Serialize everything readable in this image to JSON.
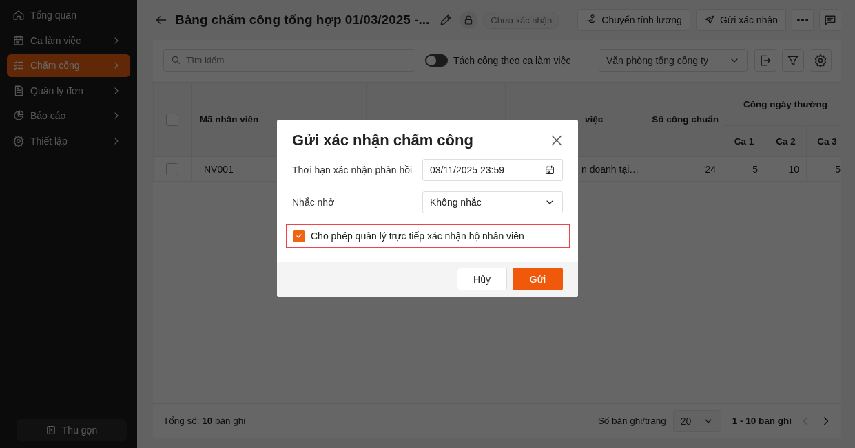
{
  "sidebar": {
    "items": [
      {
        "label": "Tổng quan",
        "has_children": false,
        "selected": false
      },
      {
        "label": "Ca làm việc",
        "has_children": true,
        "selected": false
      },
      {
        "label": "Chấm công",
        "has_children": true,
        "selected": true
      },
      {
        "label": "Quản lý đơn",
        "has_children": true,
        "selected": false
      },
      {
        "label": "Báo cáo",
        "has_children": true,
        "selected": false
      },
      {
        "label": "Thiết lập",
        "has_children": true,
        "selected": false
      }
    ],
    "collapse_button": "Thu gọn"
  },
  "header": {
    "title": "Bảng chấm công tổng hợp 01/03/2025 -...",
    "status": "Chưa xác nhận",
    "buttons": [
      {
        "kind": "payroll",
        "label": "Chuyển tính lương"
      },
      {
        "kind": "send",
        "label": "Gửi xác nhận"
      }
    ]
  },
  "toolbar": {
    "search": {
      "placeholder": "Tìm kiếm"
    },
    "toggle": {
      "label": "Tách công theo ca làm việc",
      "on": false
    },
    "unit_select": "Văn phòng tổng công ty"
  },
  "table": {
    "select_all_checked": false,
    "columns": [
      {
        "label": "Mã nhân viên"
      },
      {},
      {},
      {
        "label": "việc"
      },
      {
        "label": "Số công chuẩn"
      }
    ],
    "group": {
      "label": "Công ngày thường",
      "columns": [
        "Ca 1",
        "Ca 2",
        "Ca 3"
      ]
    },
    "rows": [
      {
        "checked": false,
        "cells": [
          "NV001",
          "",
          "",
          "n doanh tại…",
          "24",
          "5",
          "10",
          "5"
        ]
      }
    ]
  },
  "footer": {
    "total": "Tổng số: **10** bản ghi",
    "page_size_label": "Số bản ghi/trang",
    "page_size": "20",
    "range": "1 - 10 bản ghi",
    "prev_disabled": true,
    "next_disabled": false
  },
  "dialog": {
    "title": "Gửi xác nhận chấm công",
    "fields": [
      {
        "kind": "date",
        "label": "Thơi hạn xác nhận phản hồi",
        "value": "03/11/2025 23:59"
      },
      {
        "kind": "select",
        "label": "Nhắc nhở",
        "value": "Không nhắc"
      }
    ],
    "option": {
      "label": "Cho phép quản lý trực tiếp xác nhận hộ nhân viên",
      "checked": true,
      "highlighted": true
    },
    "buttons": [
      {
        "kind": "secondary",
        "label": "Hủy"
      },
      {
        "kind": "primary",
        "label": "Gửi"
      }
    ]
  }
}
